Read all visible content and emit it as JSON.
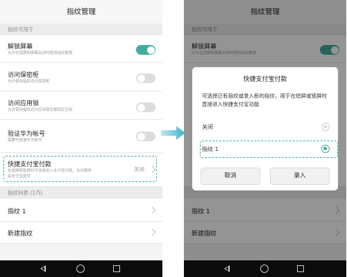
{
  "colors": {
    "accent": "#43ab9e",
    "highlight": "#3aa8a8"
  },
  "left": {
    "title": "指纹管理",
    "section_usable": "指纹可用于",
    "items": [
      {
        "title": "解锁屏幕",
        "sub": "允许在锁屏和屏幕关闭时使用指纹解锁",
        "toggle": "on"
      },
      {
        "title": "访问保密柜",
        "sub": "允许使用指纹访问保密柜",
        "toggle": "off"
      },
      {
        "title": "访问应用锁",
        "sub": "允许使用指纹访问应用锁及被锁定应用",
        "toggle": "off"
      },
      {
        "title": "验证华为帐号",
        "sub": "需要先登录华为帐号",
        "toggle": "off"
      }
    ],
    "alipay": {
      "title": "快捷支付宝付款",
      "sub_line1": "在熄屏和锁屏时可快速进入支付宝付款，支付服务",
      "sub_line2": "由支付宝提供",
      "status": "关闭"
    },
    "section_list": "指纹列表 (1/5)",
    "fingerprint_1": "指纹 1",
    "new_fingerprint": "新建指纹"
  },
  "right": {
    "title": "指纹管理",
    "section_usable": "指纹可用于",
    "first_item": {
      "title": "解锁屏幕",
      "sub": "允许在锁屏和屏幕关闭时使用指纹解锁"
    },
    "fingerprint_1": "指纹 1",
    "new_fingerprint": "新建指纹",
    "dialog": {
      "title": "快捷支付宝付款",
      "message": "可选择已有指纹或录入新的指纹，用于在熄屏或锁屏时直接进入快捷支付宝功能",
      "options": [
        {
          "label": "关闭",
          "selected": false
        },
        {
          "label": "指纹 1",
          "selected": true
        }
      ],
      "cancel": "取消",
      "enroll": "录入"
    }
  },
  "icons": {
    "chevron": "chevron-right-icon",
    "arrow": "arrow-right-icon",
    "nav_back": "back-triangle-icon",
    "nav_home": "home-circle-icon",
    "nav_recent": "recent-square-icon"
  }
}
